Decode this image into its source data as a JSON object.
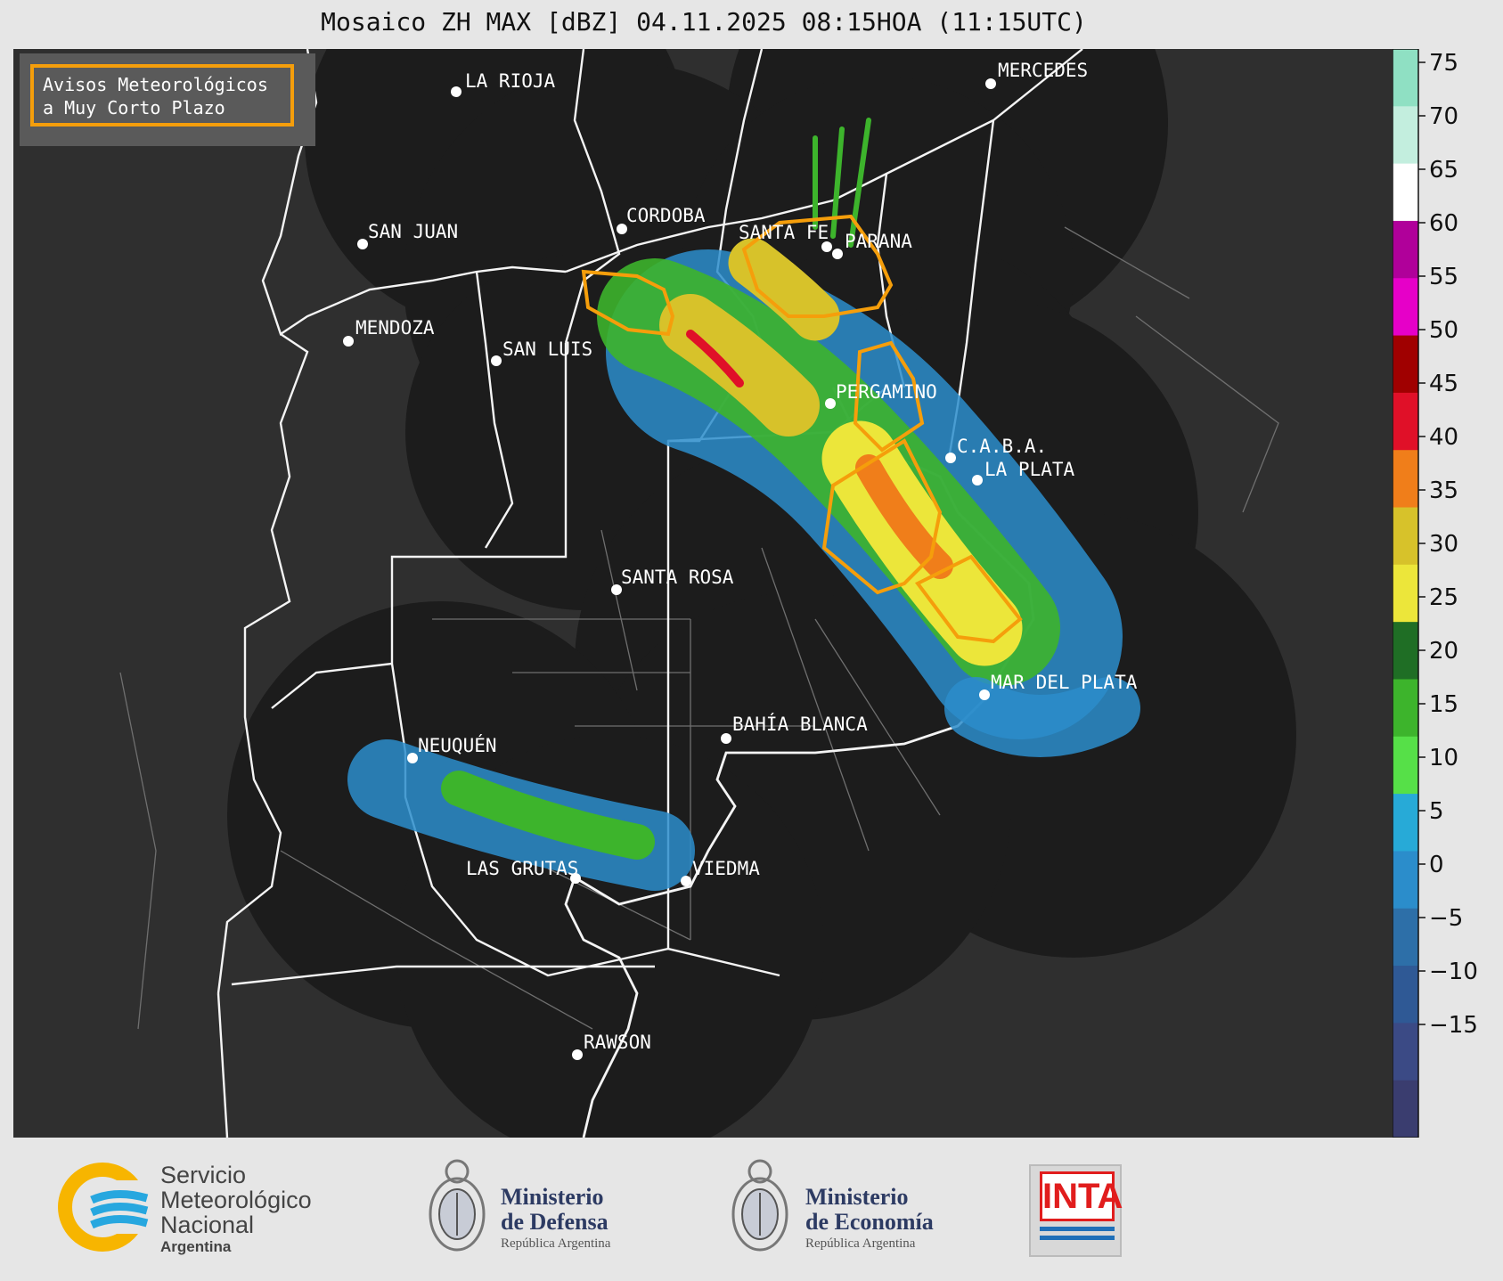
{
  "title": "Mosaico ZH MAX [dBZ] 04.11.2025 08:15HOA (11:15UTC)",
  "legend": {
    "line1": "Avisos Meteorológicos",
    "line2": "a Muy Corto Plazo",
    "warning_color": "#f59e0b"
  },
  "cities": [
    {
      "name": "LA RIOJA"
    },
    {
      "name": "MERCEDES"
    },
    {
      "name": "SAN JUAN"
    },
    {
      "name": "CORDOBA"
    },
    {
      "name": "SANTA FE"
    },
    {
      "name": "PARANA"
    },
    {
      "name": "MENDOZA"
    },
    {
      "name": "SAN LUIS"
    },
    {
      "name": "PERGAMINO"
    },
    {
      "name": "C.A.B.A."
    },
    {
      "name": "LA PLATA"
    },
    {
      "name": "SANTA ROSA"
    },
    {
      "name": "MAR DEL PLATA"
    },
    {
      "name": "BAHÍA BLANCA"
    },
    {
      "name": "NEUQUÉN"
    },
    {
      "name": "LAS GRUTAS"
    },
    {
      "name": "VIEDMA"
    },
    {
      "name": "RAWSON"
    }
  ],
  "colorbar": {
    "unit": "dBZ",
    "ticks": [
      "75",
      "70",
      "65",
      "60",
      "55",
      "50",
      "45",
      "40",
      "35",
      "30",
      "25",
      "20",
      "15",
      "10",
      "5",
      "0",
      "−5",
      "−10",
      "−15"
    ],
    "colors": [
      "#8fe0c3",
      "#c3eede",
      "#ffffff",
      "#b0009a",
      "#e600c8",
      "#a00000",
      "#e01028",
      "#f07e1a",
      "#d7c22a",
      "#ece63a",
      "#1f6e25",
      "#3db42c",
      "#56e048",
      "#27aad7",
      "#2b8dcb",
      "#2d6fa8",
      "#2f5995",
      "#3b4a85",
      "#3a3d6f"
    ]
  },
  "logos": {
    "smn": {
      "line1": "Servicio",
      "line2": "Meteorológico",
      "line3": "Nacional",
      "line4": "Argentina"
    },
    "defensa": {
      "line1": "Ministerio",
      "line2": "de Defensa",
      "line3": "República Argentina"
    },
    "economia": {
      "line1": "Ministerio",
      "line2": "de Economía",
      "line3": "República Argentina"
    },
    "inta": {
      "word": "INTA"
    }
  }
}
